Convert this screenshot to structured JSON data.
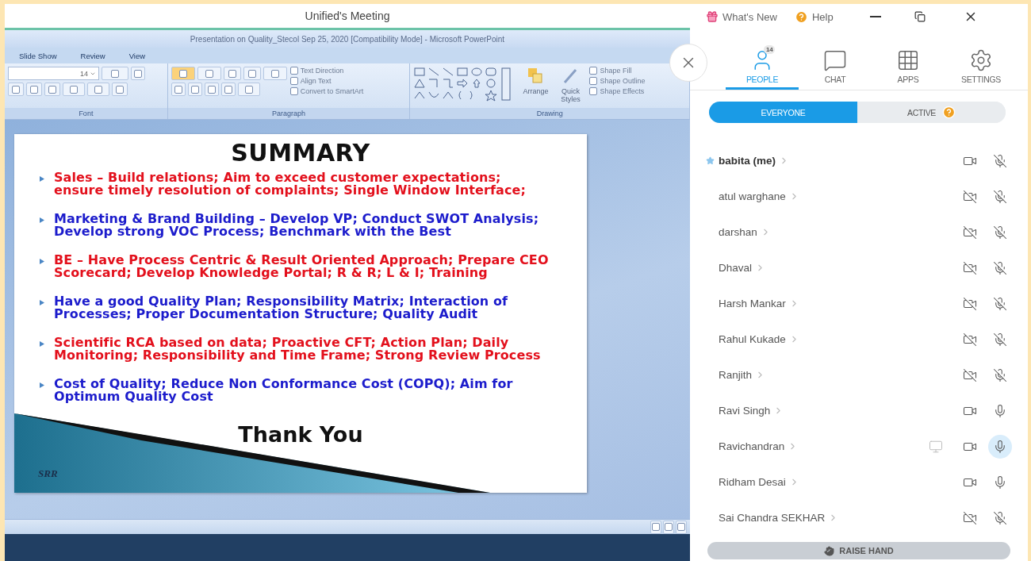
{
  "window": {
    "title": "Unified's Meeting"
  },
  "shared_screen": {
    "app_title": "Presentation on Quality_Stecol Sep 25, 2020 [Compatibility Mode] - Microsoft PowerPoint",
    "ribbon_tabs": [
      "Slide Show",
      "Review",
      "View"
    ],
    "font_size": "14",
    "paragraph_commands": [
      "Text Direction",
      "Align Text",
      "Convert to SmartArt"
    ],
    "drawing_commands": [
      "Arrange",
      "Quick Styles"
    ],
    "shape_commands": [
      "Shape Fill",
      "Shape Outline",
      "Shape Effects"
    ],
    "groups": [
      "Font",
      "Paragraph",
      "Drawing"
    ],
    "slide": {
      "title": "SUMMARY",
      "bullets": [
        {
          "lines": [
            "Sales – Build relations; Aim to exceed customer expectations;",
            "ensure timely resolution of  complaints; Single Window Interface;"
          ],
          "color": "#e3101c"
        },
        {
          "lines": [
            "Marketing & Brand Building – Develop VP; Conduct SWOT Analysis;",
            "Develop strong VOC Process; Benchmark with the Best"
          ],
          "color": "#1c1ccc"
        },
        {
          "lines": [
            "BE – Have Process Centric & Result Oriented Approach; Prepare CEO",
            "Scorecard; Develop Knowledge Portal; R & R; L & I; Training"
          ],
          "color": "#e3101c"
        },
        {
          "lines": [
            "Have a good  Quality Plan; Responsibility Matrix; Interaction of",
            "Processes; Proper Documentation Structure; Quality Audit"
          ],
          "color": "#1c1ccc"
        },
        {
          "lines": [
            "Scientific RCA based on  data; Proactive CFT; Action Plan; Daily",
            "Monitoring; Responsibility and Time Frame; Strong Review Process"
          ],
          "color": "#e3101c"
        },
        {
          "lines": [
            "Cost of  Quality; Reduce Non Conformance Cost (COPQ); Aim for",
            "Optimum Quality Cost"
          ],
          "color": "#1c1ccc"
        }
      ],
      "closing": "Thank You",
      "footer": "SRR"
    }
  },
  "panel": {
    "top_links": [
      {
        "label": "What's New",
        "kind": "gift"
      },
      {
        "label": "Help",
        "kind": "help"
      }
    ],
    "tabs": [
      {
        "label": "PEOPLE",
        "kind": "people",
        "selected": true,
        "badge": "14"
      },
      {
        "label": "CHAT",
        "kind": "chat",
        "selected": false
      },
      {
        "label": "APPS",
        "kind": "apps",
        "selected": false
      },
      {
        "label": "SETTINGS",
        "kind": "settings",
        "selected": false
      }
    ],
    "filters": [
      {
        "label": "EVERYONE",
        "selected": true,
        "help": false
      },
      {
        "label": "ACTIVE",
        "selected": false,
        "help": true
      }
    ],
    "participants": [
      {
        "name": "babita (me)",
        "me": true,
        "sharing": false,
        "video": true,
        "mic": false,
        "speaking": false
      },
      {
        "name": "atul warghane",
        "me": false,
        "sharing": false,
        "video": false,
        "mic": false,
        "speaking": false
      },
      {
        "name": "darshan",
        "me": false,
        "sharing": false,
        "video": false,
        "mic": false,
        "speaking": false
      },
      {
        "name": "Dhaval",
        "me": false,
        "sharing": false,
        "video": false,
        "mic": false,
        "speaking": false
      },
      {
        "name": "Harsh Mankar",
        "me": false,
        "sharing": false,
        "video": false,
        "mic": false,
        "speaking": false
      },
      {
        "name": "Rahul Kukade",
        "me": false,
        "sharing": false,
        "video": false,
        "mic": false,
        "speaking": false
      },
      {
        "name": "Ranjith",
        "me": false,
        "sharing": false,
        "video": false,
        "mic": false,
        "speaking": false
      },
      {
        "name": "Ravi Singh",
        "me": false,
        "sharing": false,
        "video": true,
        "mic": true,
        "speaking": false
      },
      {
        "name": "Ravichandran",
        "me": false,
        "sharing": true,
        "video": true,
        "mic": true,
        "speaking": true
      },
      {
        "name": "Ridham Desai",
        "me": false,
        "sharing": false,
        "video": true,
        "mic": true,
        "speaking": false
      },
      {
        "name": "Sai Chandra SEKHAR",
        "me": false,
        "sharing": false,
        "video": false,
        "mic": false,
        "speaking": false
      }
    ],
    "raise_hand": "RAISE HAND"
  }
}
